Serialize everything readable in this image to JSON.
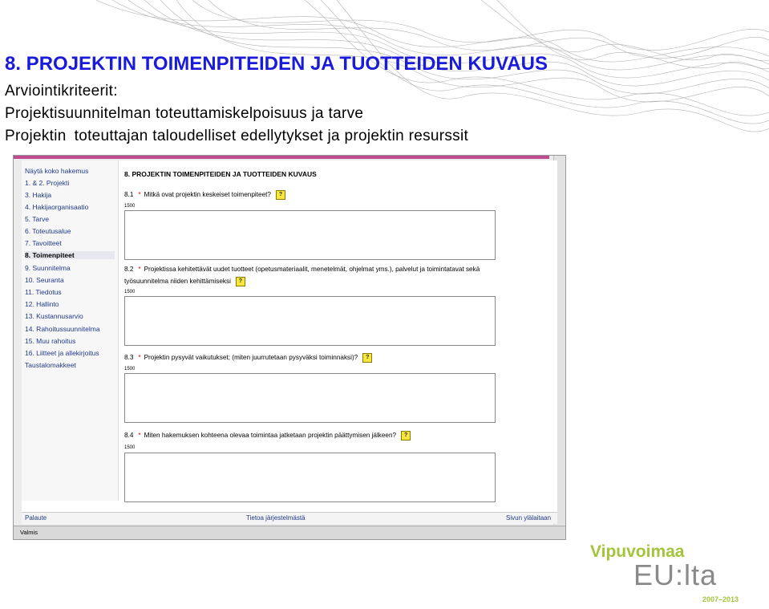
{
  "slide": {
    "title": "8.  PROJEKTIN TOIMENPITEIDEN JA TUOTTEIDEN KUVAUS",
    "criteria_heading": "Arviointikriteerit:",
    "criteria_1": "Projektisuunnitelman toteuttamiskelpoisuus ja tarve",
    "criteria_2_a": "Projektin",
    "criteria_2_b": "toteuttajan taloudelliset edellytykset ja projektin resurssit"
  },
  "sidebar": {
    "items": [
      {
        "label": "Näytä koko hakemus",
        "active": false
      },
      {
        "label": "1. & 2. Projekti",
        "active": false
      },
      {
        "label": "3. Hakija",
        "active": false
      },
      {
        "label": "4. Hakijaorganisaatio",
        "active": false
      },
      {
        "label": "5. Tarve",
        "active": false
      },
      {
        "label": "6. Toteutusalue",
        "active": false
      },
      {
        "label": "7. Tavoitteet",
        "active": false
      },
      {
        "label": "8. Toimenpiteet",
        "active": true
      },
      {
        "label": "9. Suunnitelma",
        "active": false
      },
      {
        "label": "10. Seuranta",
        "active": false
      },
      {
        "label": "11. Tiedotus",
        "active": false
      },
      {
        "label": "12. Hallinto",
        "active": false
      },
      {
        "label": "13. Kustannusarvio",
        "active": false
      },
      {
        "label": "14. Rahoitussuunnitelma",
        "active": false
      },
      {
        "label": "15. Muu rahoitus",
        "active": false
      },
      {
        "label": "16. Liitteet ja allekirjoitus",
        "active": false
      },
      {
        "label": "Taustalomakkeet",
        "active": false
      }
    ]
  },
  "form": {
    "section_title": "8.  PROJEKTIN TOIMENPITEIDEN JA TUOTTEIDEN KUVAUS",
    "questions": [
      {
        "num": "8.1",
        "star": "*",
        "text": "Mitkä ovat projektin keskeiset toimenpiteet?",
        "text2": "",
        "limit": "1500",
        "help": "?",
        "value": ""
      },
      {
        "num": "8.2",
        "star": "*",
        "text": "Projektissa kehitettävät uudet tuotteet (opetusmateriaalit, menetelmät, ohjelmat yms.), palvelut ja toimintatavat sekä",
        "text2": "työsuunnitelma niiden kehittämiseksi",
        "limit": "1500",
        "help": "?",
        "value": ""
      },
      {
        "num": "8.3",
        "star": "*",
        "text": "Projektin pysyvät vaikutukset; (miten juurrutetaan pysyväksi toiminnaksi)?",
        "text2": "",
        "limit": "1500",
        "help": "?",
        "value": ""
      },
      {
        "num": "8.4",
        "star": "*",
        "text": "Miten hakemuksen kohteena olevaa toimintaa jatketaan projektin päättymisen jälkeen?",
        "text2": "",
        "limit": "1500",
        "help": "?",
        "value": ""
      }
    ]
  },
  "footer": {
    "back": "Palaute",
    "info": "Tietoa järjestelmästä",
    "top": "Sivun ylälaitaan",
    "status": "Valmis"
  },
  "logo": {
    "line1": "Vipuvoimaa",
    "line2": "EU:lta",
    "line3": "2007–2013"
  },
  "colors": {
    "title": "#1a1adb",
    "accent": "#c04a8e",
    "logo_green": "#a3c43b",
    "logo_gray": "#8a8a8a",
    "link": "#1e3a8a"
  }
}
